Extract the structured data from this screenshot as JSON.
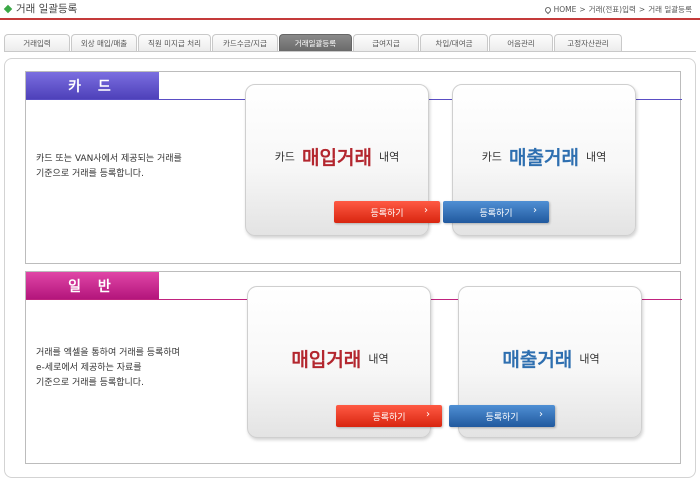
{
  "header": {
    "title": "거래 일괄등록",
    "breadcrumb": [
      "HOME",
      "거래(전표)입력",
      "거래 일괄등록"
    ],
    "breadcrumb_sep": ">"
  },
  "tabs": [
    {
      "label": "거래입력",
      "active": false
    },
    {
      "label": "외상 매입/매출",
      "active": false
    },
    {
      "label": "직원 미지급 처리",
      "active": false
    },
    {
      "label": "카드수금/지급",
      "active": false
    },
    {
      "label": "거래일괄등록",
      "active": true
    },
    {
      "label": "급여지급",
      "active": false
    },
    {
      "label": "차입/대여금",
      "active": false
    },
    {
      "label": "어음관리",
      "active": false
    },
    {
      "label": "고정자산관리",
      "active": false
    }
  ],
  "card_section": {
    "label": "카 드",
    "desc_line1": "카드 또는 VAN사에서 제공되는 거래를",
    "desc_line2": "기준으로 거래를 등록합니다.",
    "purchase": {
      "prefix": "카드",
      "main": "매입거래",
      "suffix": "내역",
      "button": "등록하기"
    },
    "sales": {
      "prefix": "카드",
      "main": "매출거래",
      "suffix": "내역",
      "button": "등록하기"
    }
  },
  "general_section": {
    "label": "일 반",
    "desc_line1": "거래를 엑셀을 통하여 거래를 등록하며",
    "desc_line2": "e-세로에서 제공하는 자료를",
    "desc_line3": "기준으로 거래를 등록합니다.",
    "purchase": {
      "main": "매입거래",
      "suffix": "내역",
      "button": "등록하기"
    },
    "sales": {
      "main": "매출거래",
      "suffix": "내역",
      "button": "등록하기"
    }
  },
  "icons": {
    "title": "green-diamond-icon",
    "home": "location-pin-icon",
    "button_arrow": "chevron-right-icon"
  },
  "colors": {
    "header_line": "#c43a3a",
    "card_label": "#5a4ec4",
    "general_label": "#c0237f",
    "purchase_text": "#b3262e",
    "sales_text": "#2e6fb0",
    "purchase_button": "#e0301a",
    "sales_button": "#2c68ae"
  }
}
